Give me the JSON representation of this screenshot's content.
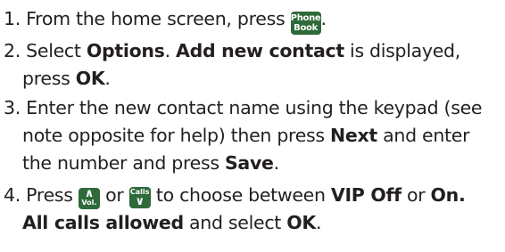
{
  "steps": [
    {
      "num": "1.",
      "pre": " From the home screen, press ",
      "key": {
        "line1": "Phone",
        "line2": "Book",
        "icon": "phone-book-key-icon"
      },
      "post": "."
    },
    {
      "num": "2.",
      "pre": "  Select ",
      "b1": "Options",
      "mid1": ". ",
      "b2": "Add new contact",
      "mid2": " is displayed,",
      "line2_pre": "press ",
      "line2_b": "OK",
      "line2_post": "."
    },
    {
      "num": "3.",
      "line1": " Enter the new contact name using the keypad (see",
      "line2_pre": "note opposite for help) then press ",
      "line2_b": "Next",
      "line2_post": " and enter",
      "line3_pre": "the number and press ",
      "line3_b": "Save",
      "line3_post": "."
    },
    {
      "num": "4.",
      "pre": " Press ",
      "key_vol": {
        "label": "Vol.",
        "icon": "vol-up-key-icon"
      },
      "or": " or ",
      "key_calls": {
        "label": "Calls",
        "icon": "calls-down-key-icon"
      },
      "mid": " to choose between ",
      "b1": "VIP Off",
      "mid2": " or ",
      "b2": "On.",
      "line2_b": "All calls allowed",
      "line2_mid": " and select ",
      "line2_b2": "OK",
      "line2_post": "."
    }
  ],
  "colors": {
    "text": "#231f20",
    "key_bg": "#2e6a3a"
  }
}
